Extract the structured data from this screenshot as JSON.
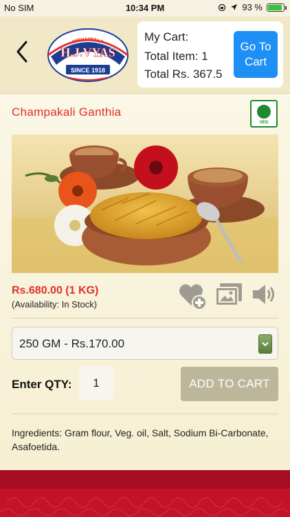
{
  "status_bar": {
    "carrier": "No SIM",
    "time": "10:34 PM",
    "battery_percent": "93 %",
    "battery_level": 0.93
  },
  "header": {
    "logo": {
      "top_text": "MITHAIWALA",
      "brand": "H.J.VYAS",
      "since": "SINCE 1918"
    },
    "cart": {
      "title": "My Cart:",
      "total_items": "Total Item: 1",
      "total_amount": "Total Rs. 367.5",
      "go_button": "Go To Cart"
    }
  },
  "product": {
    "name": "Champakali Ganthia",
    "veg_badge": "VEG",
    "price": "Rs.680.00 (1 KG)",
    "availability": "(Availability: In Stock)",
    "selected_size": "250 GM - Rs.170.00",
    "qty_label": "Enter QTY:",
    "qty_value": "1",
    "add_to_cart": "ADD TO CART",
    "ingredients": "Ingredients: Gram flour, Veg. oil, Salt, Sodium Bi-Carbonate, Asafoetida."
  },
  "icons": {
    "back": "chevron-left-icon",
    "wishlist": "heart-plus-icon",
    "gallery": "gallery-icon",
    "audio": "speaker-icon",
    "dropdown": "chevron-down-icon"
  },
  "colors": {
    "accent_red": "#e0302a",
    "button_blue": "#1e90f5",
    "veg_green": "#1d8a2c",
    "footer_red": "#c3122a"
  }
}
